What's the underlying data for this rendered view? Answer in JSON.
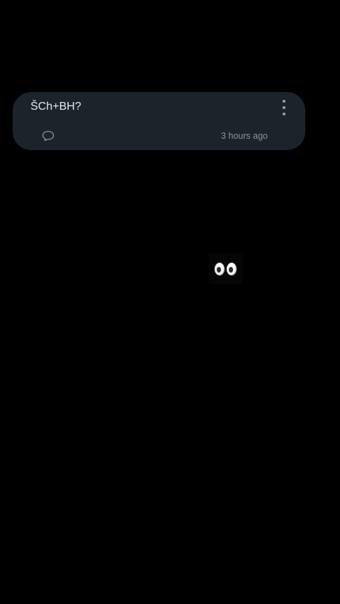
{
  "post": {
    "title": "ŠCh+BH?",
    "timestamp": "3 hours ago",
    "icons": {
      "more": "more-vertical-icon",
      "comment": "comment-bubble-icon"
    }
  },
  "emoji": {
    "icon": "eyes-icon"
  },
  "colors": {
    "background": "#000000",
    "card": "#1c232b",
    "title_text": "#e8eaec",
    "secondary_text": "#8c939a"
  }
}
